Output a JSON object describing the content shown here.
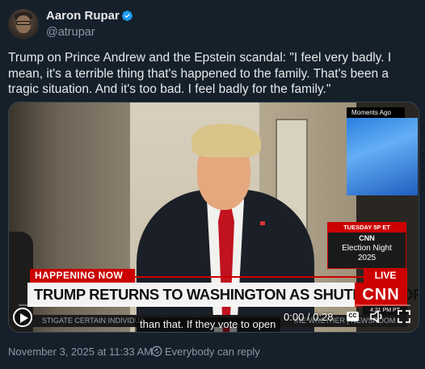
{
  "author": {
    "name": "Aaron Rupar",
    "handle": "@atrupar",
    "verified": true
  },
  "tweet": {
    "text": "Trump on Prince Andrew and the Epstein scandal: \"I feel very badly. I mean, it's a terrible thing that's happened to the family. That's been a tragic situation. And it's too bad. I feel badly for the family.\""
  },
  "video": {
    "moments_label": "Moments Ago",
    "promo_top": "TUESDAY 5P ET",
    "promo_logo": "CNN",
    "promo_title_1": "Election Night",
    "promo_title_2": "2025",
    "happening_now": "HAPPENING NOW",
    "live_label": "LIVE",
    "headline": "TRUMP RETURNS TO WASHINGTON AS SHUTDOWN DRAGS ON",
    "network_logo": "CNN",
    "clock": "4:21 PM PT",
    "ticker_left": "STIGATE CERTAIN INDIVIDUA",
    "ticker_right": "INE WRETHER | NEWSROOM",
    "caption": "than that. If they vote to open",
    "time": "0:00 / 0:28",
    "cc_label": "CC",
    "progress": 0
  },
  "footer": {
    "timestamp": "November 3, 2025 at 11:33 AM",
    "reply_setting": "Everybody can reply"
  },
  "colors": {
    "background": "#15202b",
    "verified": "#1d9bf0",
    "cnn_red": "#cc0000",
    "muted_text": "#8b98a5"
  },
  "icons": [
    "verified-icon",
    "play-icon",
    "captions-icon",
    "volume-icon",
    "fullscreen-icon",
    "reply-permission-icon"
  ]
}
